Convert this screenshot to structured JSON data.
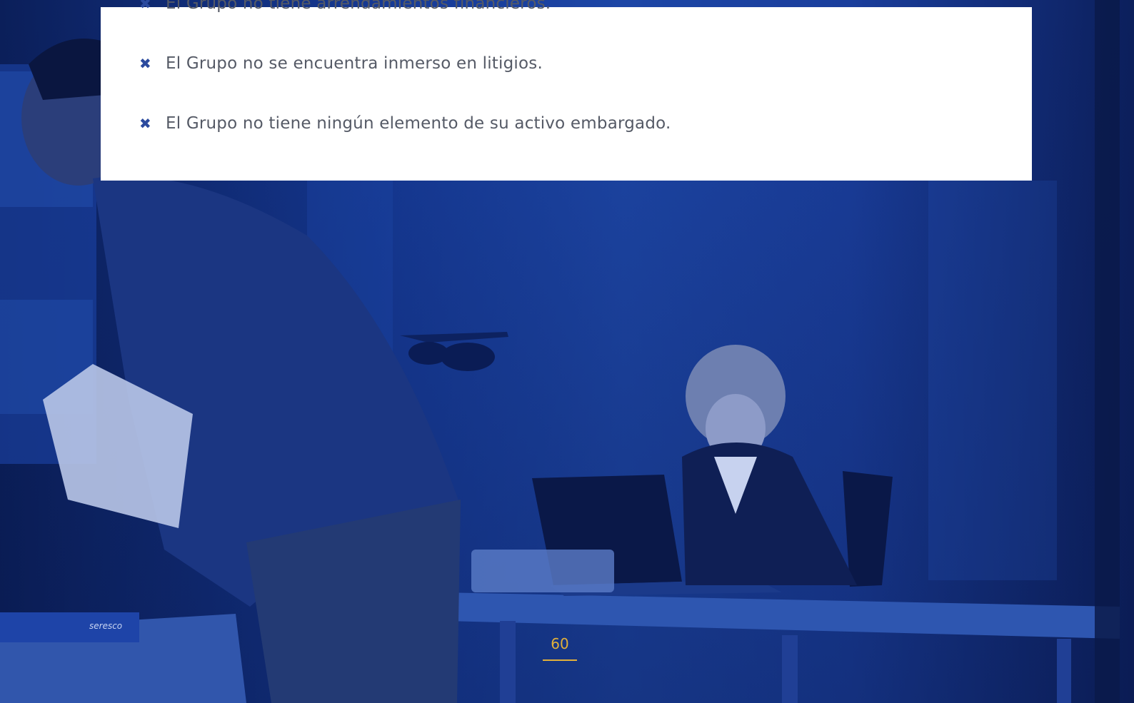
{
  "document": {
    "list_items": [
      "El Grupo no tiene arrendamientos financieros.",
      "El Grupo no se encuentra inmerso en litigios.",
      "El Grupo no tiene ningún elemento de su activo embargado."
    ],
    "bullet_icon": "cross-bullet-icon",
    "page_number": "60"
  },
  "colors": {
    "overlay_blue": "#163a96",
    "accent_gold": "#e2b03a",
    "bullet_blue": "#2b4a9e",
    "text_gray": "#555a66"
  },
  "photo": {
    "logo_text": "seresco"
  }
}
